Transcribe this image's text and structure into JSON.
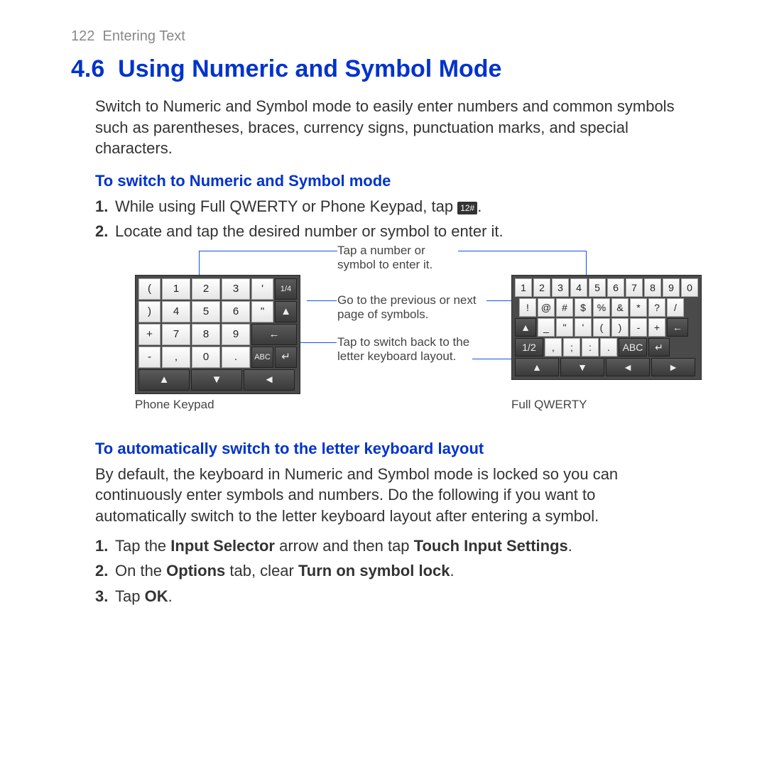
{
  "header": {
    "page_number": "122",
    "chapter": "Entering Text"
  },
  "section": {
    "number": "4.6",
    "title": "Using Numeric and Symbol Mode"
  },
  "intro": "Switch to Numeric and Symbol mode to easily enter numbers and common symbols such as parentheses, braces, currency signs, punctuation marks, and special characters.",
  "sub1": {
    "title": "To switch to Numeric and Symbol mode",
    "step1_pre": "While using Full QWERTY or Phone Keypad, tap ",
    "step1_key": "12#",
    "step1_post": ".",
    "step2": "Locate and tap the desired number or symbol to enter it."
  },
  "callouts": {
    "enter": "Tap a number or symbol to enter it.",
    "page": "Go to the previous or next page of symbols.",
    "abc": "Tap to switch back to the letter keyboard layout."
  },
  "phone_keypad": {
    "caption": "Phone Keypad",
    "rows": [
      [
        "(",
        "1",
        "2",
        "3",
        "'"
      ],
      [
        ")",
        "4",
        "5",
        "6",
        "\""
      ],
      [
        "+",
        "7",
        "8",
        "9"
      ],
      [
        "-",
        ",",
        "0",
        ".",
        "ABC"
      ]
    ],
    "page_indicator": "1/4"
  },
  "qwerty_keypad": {
    "caption": "Full QWERTY",
    "rows": [
      [
        "1",
        "2",
        "3",
        "4",
        "5",
        "6",
        "7",
        "8",
        "9",
        "0"
      ],
      [
        "!",
        "@",
        "#",
        "$",
        "%",
        "&",
        "*",
        "?",
        "/"
      ],
      [
        "_",
        "\"",
        "'",
        "(",
        ")",
        "-",
        "+"
      ]
    ],
    "bottom": {
      "page": "1/2",
      "punc": [
        ",",
        ";",
        ":",
        "."
      ],
      "abc": "ABC"
    }
  },
  "sub2": {
    "title": "To automatically switch to the letter keyboard layout",
    "para": "By default, the keyboard in Numeric and Symbol mode is locked so you can continuously enter symbols and numbers. Do the following if you want to automatically switch to the letter keyboard layout after entering a symbol.",
    "step1_a": "Tap the ",
    "step1_b": "Input Selector",
    "step1_c": " arrow and then tap ",
    "step1_d": "Touch Input Settings",
    "step1_e": ".",
    "step2_a": "On the ",
    "step2_b": "Options",
    "step2_c": " tab, clear ",
    "step2_d": "Turn on symbol lock",
    "step2_e": ".",
    "step3_a": "Tap ",
    "step3_b": "OK",
    "step3_c": "."
  },
  "nums": {
    "n1": "1.",
    "n2": "2.",
    "n3": "3."
  }
}
